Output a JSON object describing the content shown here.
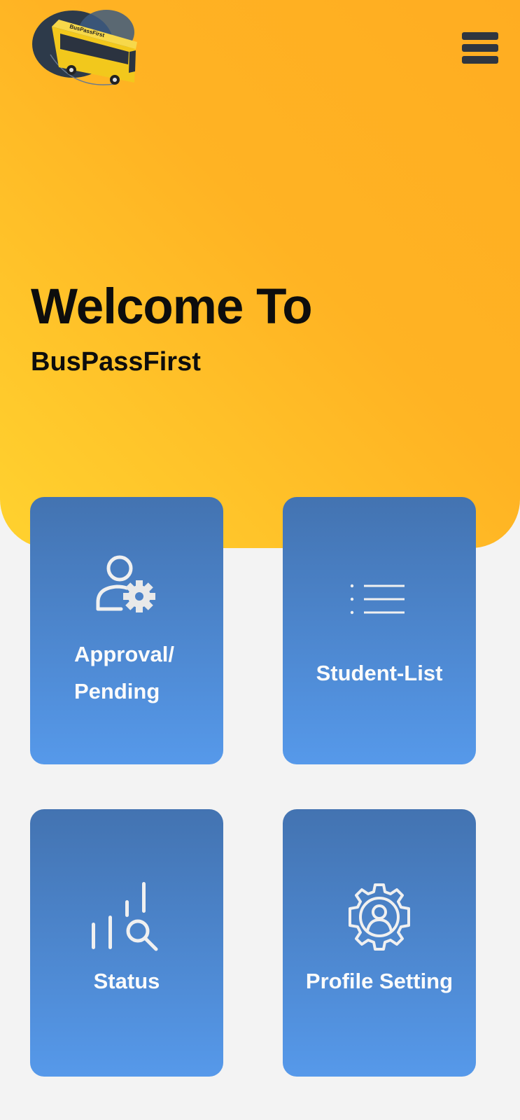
{
  "header": {
    "logo_icon": "bus-logo",
    "logo_text": "BusPassFirst",
    "menu_icon": "hamburger-menu-icon"
  },
  "hero": {
    "title": "Welcome To",
    "subtitle": "BusPassFirst"
  },
  "cards": [
    {
      "label_line1": "Approval/",
      "label_line2": "Pending",
      "icon": "user-gear-icon"
    },
    {
      "label": "Student-List",
      "icon": "list-icon"
    },
    {
      "label": "Status",
      "icon": "chart-search-icon"
    },
    {
      "label": "Profile Setting",
      "icon": "profile-gear-icon"
    }
  ],
  "colors": {
    "hero_gradient_start": "#ffad22",
    "hero_gradient_end": "#ffd22f",
    "card_gradient_top": "#4373b1",
    "card_gradient_bottom": "#5699ea",
    "background": "#f3f3f3"
  }
}
